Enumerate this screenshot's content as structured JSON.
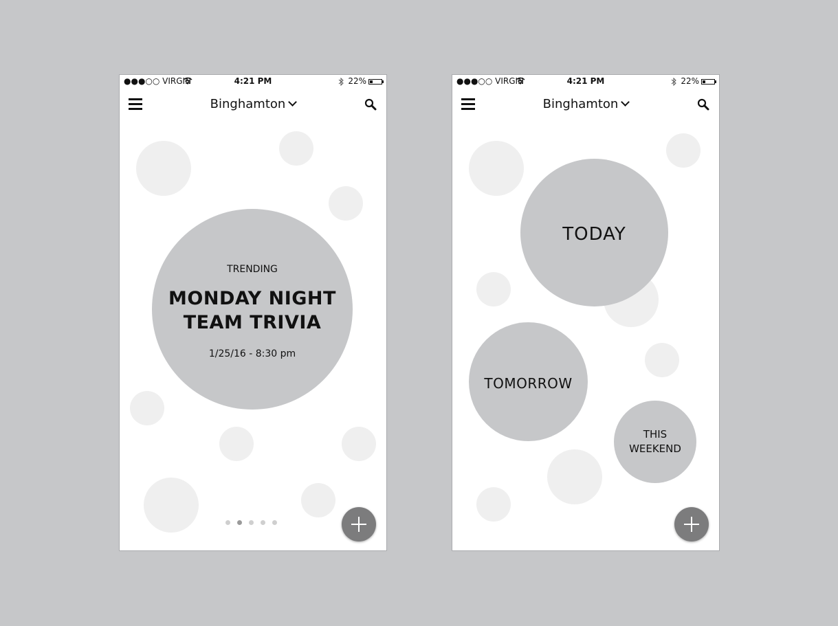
{
  "status_bar": {
    "carrier": "●●●○○ VIRGIN",
    "time": "4:21 PM",
    "battery": "22%",
    "battery_level": 0.22
  },
  "nav": {
    "city": "Binghamton",
    "menu_icon": "hamburger-icon",
    "search_icon": "search-icon",
    "dropdown_icon": "chevron-down-icon"
  },
  "screen1": {
    "trending_label": "TRENDING",
    "event_title_line1": "MONDAY NIGHT",
    "event_title_line2": "TEAM TRIVIA",
    "event_datetime": "1/25/16 - 8:30 pm",
    "page_dots": {
      "count": 5,
      "active_index": 1
    }
  },
  "screen2": {
    "today": "TODAY",
    "tomorrow": "TOMORROW",
    "weekend_line1": "THIS",
    "weekend_line2": "WEEKEND"
  },
  "fab_icon": "plus-icon",
  "colors": {
    "background": "#c6c7c9",
    "bubble_dark": "#c6c7c9",
    "bubble_light": "#efefef",
    "fab": "#7c7c7d"
  }
}
